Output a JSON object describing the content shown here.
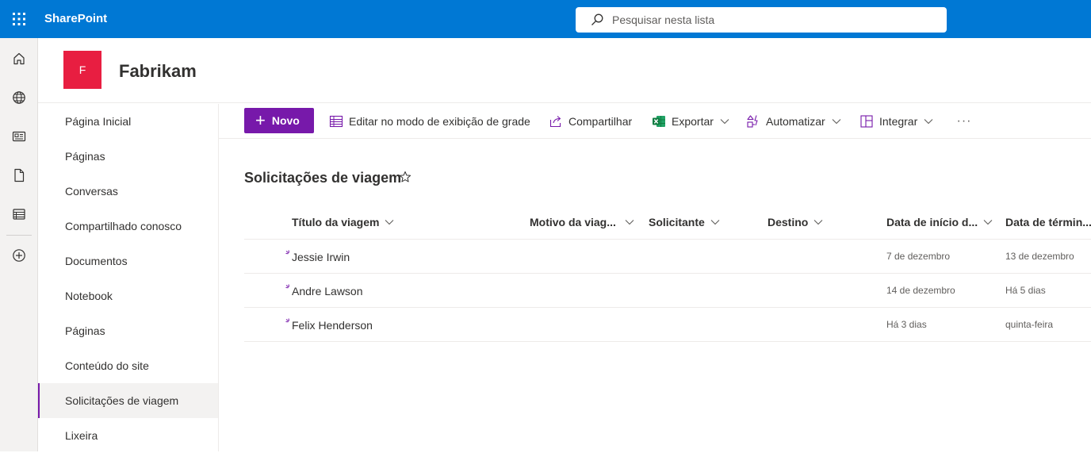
{
  "topbar": {
    "app_name": "SharePoint",
    "search_placeholder": "Pesquisar nesta lista",
    "brand_color": "#0078d4"
  },
  "appbar": {
    "icons": [
      "home-icon",
      "globe-icon",
      "news-icon",
      "document-icon",
      "lists-icon",
      "add-circle-icon"
    ]
  },
  "site": {
    "logo_letter": "F",
    "logo_color": "#e81e41",
    "name": "Fabrikam"
  },
  "nav": {
    "items": [
      {
        "label": "Página Inicial"
      },
      {
        "label": "Páginas"
      },
      {
        "label": "Conversas"
      },
      {
        "label": "Compartilhado conosco"
      },
      {
        "label": "Documentos"
      },
      {
        "label": "Notebook"
      },
      {
        "label": "Páginas"
      },
      {
        "label": "Conteúdo do site"
      },
      {
        "label": "Solicitações de viagem"
      },
      {
        "label": "Lixeira"
      }
    ],
    "selected": "Solicitações de viagem",
    "accent_color": "#7719aa"
  },
  "commands": {
    "new_label": "Novo",
    "grid_label": "Editar no modo de exibição de grade",
    "share_label": "Compartilhar",
    "export_label": "Exportar",
    "automate_label": "Automatizar",
    "integrate_label": "Integrar",
    "more_label": "···"
  },
  "list": {
    "title": "Solicitações de viagem",
    "columns": [
      "Título da viagem",
      "Motivo da viag...",
      "Solicitante",
      "Destino",
      "Data de início d...",
      "Data de términ..."
    ],
    "rows": [
      {
        "title": "Jessie Irwin",
        "start": "7 de dezembro",
        "end": "13 de dezembro"
      },
      {
        "title": "Andre Lawson",
        "start": "14 de dezembro",
        "end": "Há 5 dias"
      },
      {
        "title": "Felix Henderson",
        "start": "Há 3 dias",
        "end": "quinta-feira"
      }
    ]
  }
}
